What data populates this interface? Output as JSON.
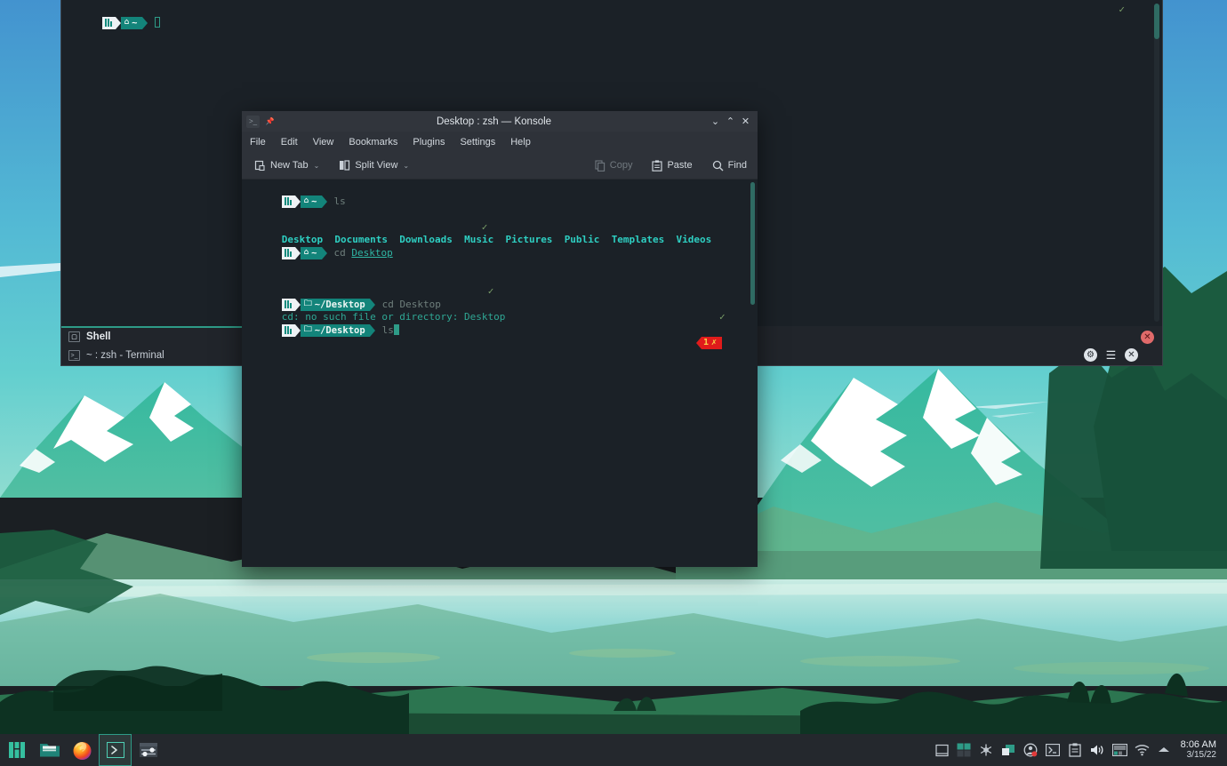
{
  "desktop": {
    "wallpaper_name": "manjaro-mountain-lake-wallpaper",
    "colors": {
      "sky_top": "#4a9fd4",
      "sky_mid": "#5cc5d8",
      "mountain_teal": "#3bbfa3",
      "forest_dark": "#153a2a",
      "lake_light": "#b9e6dd",
      "accent_teal": "#2e9b87",
      "panel_bg": "#24282d",
      "terminal_bg": "#1b2127",
      "error_red": "#e01b1b"
    }
  },
  "yakuake": {
    "terminal": {
      "prompt": {
        "logo_icon": "manjaro-logo-icon",
        "home_icon": "home-icon",
        "path": "~"
      },
      "cursor": "block-cursor",
      "status_check": "✓"
    },
    "tabs": [
      {
        "label": "Shell",
        "icon": "tab-icon",
        "active": true
      },
      {
        "label": "~ : zsh - Terminal",
        "icon": "terminal-icon",
        "active": false
      }
    ],
    "buttons": {
      "close_top": "✕",
      "gear": "⚙",
      "menu": "☰",
      "close": "✕"
    }
  },
  "konsole": {
    "title": "Desktop : zsh — Konsole",
    "title_icons": {
      "app": "terminal-icon",
      "pin": "pin-icon"
    },
    "window_buttons": {
      "minimize": "⌄",
      "maximize": "⌃",
      "close": "✕"
    },
    "menu": [
      "File",
      "Edit",
      "View",
      "Bookmarks",
      "Plugins",
      "Settings",
      "Help"
    ],
    "toolbar": {
      "new_tab": "New Tab",
      "split_view": "Split View",
      "copy": "Copy",
      "paste": "Paste",
      "find": "Find",
      "chevron": "⌄"
    },
    "terminal": {
      "prompt_home": {
        "logo_icon": "manjaro-logo-icon",
        "home_icon": "home-icon",
        "path": "~"
      },
      "prompt_desktop": {
        "logo_icon": "manjaro-logo-icon",
        "folder_icon": "folder-icon",
        "path": "~/Desktop"
      },
      "cmd_ls": "ls",
      "ls_output": [
        "Desktop",
        "Documents",
        "Downloads",
        "Music",
        "Pictures",
        "Public",
        "Templates",
        "Videos"
      ],
      "cmd_cd": "cd ",
      "cd_arg": "Desktop",
      "cmd_cd_plain": "cd Desktop",
      "error_text": "cd: no such file or directory: Desktop",
      "cmd_ls2": "ls",
      "check_mark": "✓",
      "error_badge": {
        "count": "1",
        "symbol": "✗"
      }
    }
  },
  "taskbar": {
    "launchers": [
      {
        "name": "manjaro-menu-icon",
        "label": "Manjaro Menu"
      },
      {
        "name": "file-manager-icon",
        "label": "File Manager"
      },
      {
        "name": "firefox-icon",
        "label": "Firefox"
      },
      {
        "name": "terminal-icon",
        "label": "Konsole",
        "active": true
      },
      {
        "name": "settings-icon",
        "label": "System Settings"
      }
    ],
    "tray": [
      {
        "name": "pager-icon",
        "glyph": "▢"
      },
      {
        "name": "virtual-desktops-icon",
        "glyph": "▦"
      },
      {
        "name": "notifications-icon",
        "glyph": "✻"
      },
      {
        "name": "display-icon",
        "glyph": "▧"
      },
      {
        "name": "user-account-icon",
        "glyph": "◉"
      },
      {
        "name": "terminal-tray-icon",
        "glyph": "▣"
      },
      {
        "name": "clipboard-icon",
        "glyph": "▤"
      },
      {
        "name": "volume-icon",
        "glyph": "🔊"
      },
      {
        "name": "network-manager-icon",
        "glyph": "▥"
      },
      {
        "name": "wifi-icon",
        "glyph": "◥"
      },
      {
        "name": "show-hidden-icon",
        "glyph": "▲"
      }
    ],
    "clock": {
      "time": "8:06 AM",
      "date": "3/15/22"
    }
  }
}
